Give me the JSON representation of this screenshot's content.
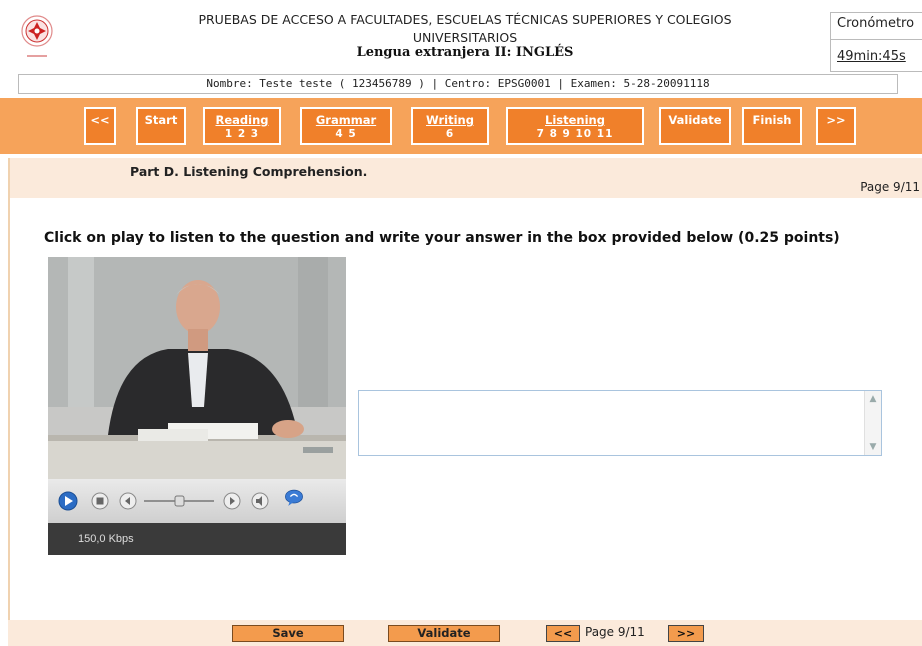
{
  "header": {
    "title_line1": "PRUEBAS DE ACCESO A FACULTADES, ESCUELAS TÉCNICAS SUPERIORES Y COLEGIOS",
    "title_line2": "UNIVERSITARIOS",
    "title_line3": "Lengua extranjera II: INGLÉS",
    "timer_label": "Cronómetro",
    "timer_value": "49min:45s",
    "logo_icon": "university-seal-icon"
  },
  "info_bar": "Nombre: Teste teste  ( 123456789 )  | Centro: EPSG0001  |  Examen: 5-28-20091118",
  "nav": {
    "prev": "<<",
    "start": "Start",
    "reading": {
      "label": "Reading",
      "pages": "1  2  3"
    },
    "grammar": {
      "label": "Grammar",
      "pages": "4  5"
    },
    "writing": {
      "label": "Writing",
      "pages": "6"
    },
    "listening": {
      "label": "Listening",
      "pages": "7  8  9  10  11"
    },
    "validate": "Validate",
    "finish": "Finish",
    "next": ">>"
  },
  "content": {
    "part_title": "Part D. Listening Comprehension.",
    "page_label": "Page 9/11",
    "instructions": "Click on play to listen to the question and write your answer in the box provided below (0.25 points)"
  },
  "player": {
    "bitrate": "150,0 Kbps",
    "controls": [
      "play-icon",
      "stop-icon",
      "rewind-icon",
      "seek-slider",
      "fast-forward-icon",
      "volume-icon",
      "chat-icon"
    ]
  },
  "answer": {
    "value": "",
    "placeholder": ""
  },
  "bottom": {
    "save": "Save",
    "validate": "Validate",
    "prev": "<<",
    "page": "Page 9/11",
    "next": ">>"
  },
  "colors": {
    "nav_bg": "#f6a35a",
    "nav_button": "#f0802a",
    "part_bar": "#fbeadb",
    "bottom_button": "#f39b4d"
  }
}
